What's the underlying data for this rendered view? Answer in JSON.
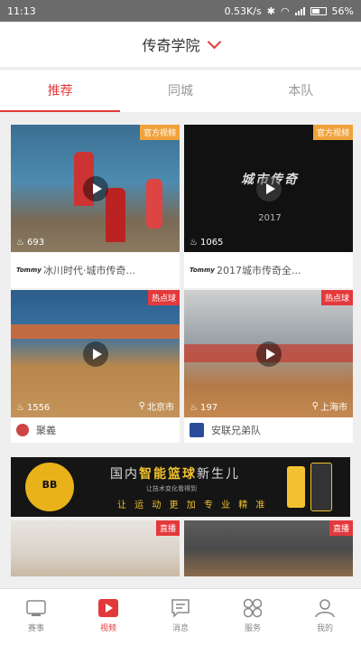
{
  "status": {
    "time": "11:13",
    "net_speed": "0.53K/s",
    "battery": "56%"
  },
  "header": {
    "title": "传奇学院"
  },
  "tabs": [
    {
      "label": "推荐"
    },
    {
      "label": "同城"
    },
    {
      "label": "本队"
    }
  ],
  "cards": [
    {
      "badge": "官方视频",
      "views": "693",
      "logo": "Tommy",
      "title": "冰川时代·城市传奇..."
    },
    {
      "badge": "官方视频",
      "views": "1065",
      "logo": "Tommy",
      "title": "2017城市传奇全...",
      "overlay_title": "城市传奇",
      "overlay_year": "2017"
    },
    {
      "badge": "热点球",
      "views": "1556",
      "location": "北京市",
      "title": "聚義"
    },
    {
      "badge": "热点球",
      "views": "197",
      "location": "上海市",
      "title": "安联兄弟队"
    },
    {
      "badge": "直播"
    },
    {
      "badge": "直播"
    }
  ],
  "banner": {
    "ball_label": "BB",
    "headline_pre": "国内",
    "headline_em": "智能篮球",
    "headline_post": "新生儿",
    "sub": "让技术变化看得到",
    "slogan": "让 运 动 更 加 专 业 精 准"
  },
  "nav": [
    {
      "label": "赛事"
    },
    {
      "label": "视频"
    },
    {
      "label": "消息"
    },
    {
      "label": "服务"
    },
    {
      "label": "我的"
    }
  ],
  "colors": {
    "accent": "#e4393c",
    "badge_orange": "#f0a23b"
  }
}
